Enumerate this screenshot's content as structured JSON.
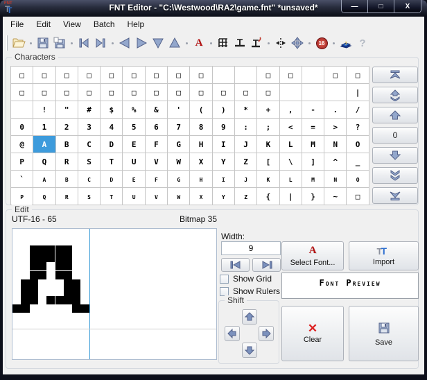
{
  "window": {
    "title": "FNT Editor - \"C:\\Westwood\\RA2\\game.fnt\" *unsaved*",
    "controls": {
      "minimize": "—",
      "maximize": "□",
      "close": "X"
    }
  },
  "menu": {
    "items": [
      "File",
      "Edit",
      "View",
      "Batch",
      "Help"
    ]
  },
  "toolbar": {
    "icons": [
      "open",
      "save",
      "save-as",
      "previous-character",
      "next-character",
      "move-left",
      "move-right",
      "move-down",
      "move-up",
      "select-font",
      "toggle-grid",
      "ruler",
      "ruler-reset",
      "shift-columns",
      "move-glyph",
      "hex-16",
      "manual",
      "context-help"
    ],
    "hex16_label": "16",
    "font_a_label": "A",
    "help_label": "?"
  },
  "characters": {
    "label": "Characters",
    "grid": [
      [
        "□",
        "□",
        "□",
        "□",
        "□",
        "□",
        "□",
        "□",
        "□",
        "",
        "",
        "□",
        "□",
        "",
        "□",
        "□"
      ],
      [
        "□",
        "□",
        "□",
        "□",
        "□",
        "□",
        "□",
        "□",
        "□",
        "□",
        "□",
        "□",
        "",
        "",
        "",
        "|"
      ],
      [
        "",
        "!",
        "\"",
        "#",
        "$",
        "%",
        "&",
        "'",
        "(",
        ")",
        "*",
        "+",
        ",",
        "-",
        ".",
        "/"
      ],
      [
        "0",
        "1",
        "2",
        "3",
        "4",
        "5",
        "6",
        "7",
        "8",
        "9",
        ":",
        ";",
        "<",
        "=",
        ">",
        "?"
      ],
      [
        "@",
        "A",
        "B",
        "C",
        "D",
        "E",
        "F",
        "G",
        "H",
        "I",
        "J",
        "K",
        "L",
        "M",
        "N",
        "O"
      ],
      [
        "P",
        "Q",
        "R",
        "S",
        "T",
        "U",
        "V",
        "W",
        "X",
        "Y",
        "Z",
        "[",
        "\\",
        "]",
        "^",
        "_"
      ],
      [
        "`",
        "a",
        "b",
        "c",
        "d",
        "e",
        "f",
        "g",
        "h",
        "i",
        "j",
        "k",
        "l",
        "m",
        "n",
        "o"
      ],
      [
        "p",
        "q",
        "r",
        "s",
        "t",
        "u",
        "v",
        "w",
        "x",
        "y",
        "z",
        "{",
        "|",
        "}",
        "~",
        "□"
      ]
    ],
    "selected": {
      "row": 4,
      "col": 1,
      "character": "A"
    },
    "scroll_zero_label": "0"
  },
  "edit": {
    "label": "Edit",
    "codepoint_label": "UTF-16 - 65",
    "bitmap_label": "Bitmap 35",
    "bitmap": {
      "width": 9,
      "cursor_column": 9,
      "rows": [
        ".........",
        ".........",
        "..XXXXX..",
        "..XXXXX..",
        "..XX.XX..",
        "..XX.XX..",
        ".XX...XX.",
        ".XX...XX.",
        ".XX.XXXX.",
        "XX.....XX",
        ".........",
        ".........",
        "........."
      ]
    },
    "width_label": "Width:",
    "width_value": "9",
    "select_font_label": "Select Font...",
    "import_label": "Import",
    "show_grid_label": "Show Grid",
    "show_rulers_label": "Show Rulers",
    "show_grid_checked": false,
    "show_rulers_checked": false,
    "preview_text": "Font Preview",
    "shift_label": "Shift",
    "clear_label": "Clear",
    "save_label": "Save"
  },
  "colors": {
    "selection": "#3d9bdc",
    "accent_red": "#b31111",
    "steel_blue": "#93a7cc",
    "titlebar_dark": "#0d0f1a"
  }
}
